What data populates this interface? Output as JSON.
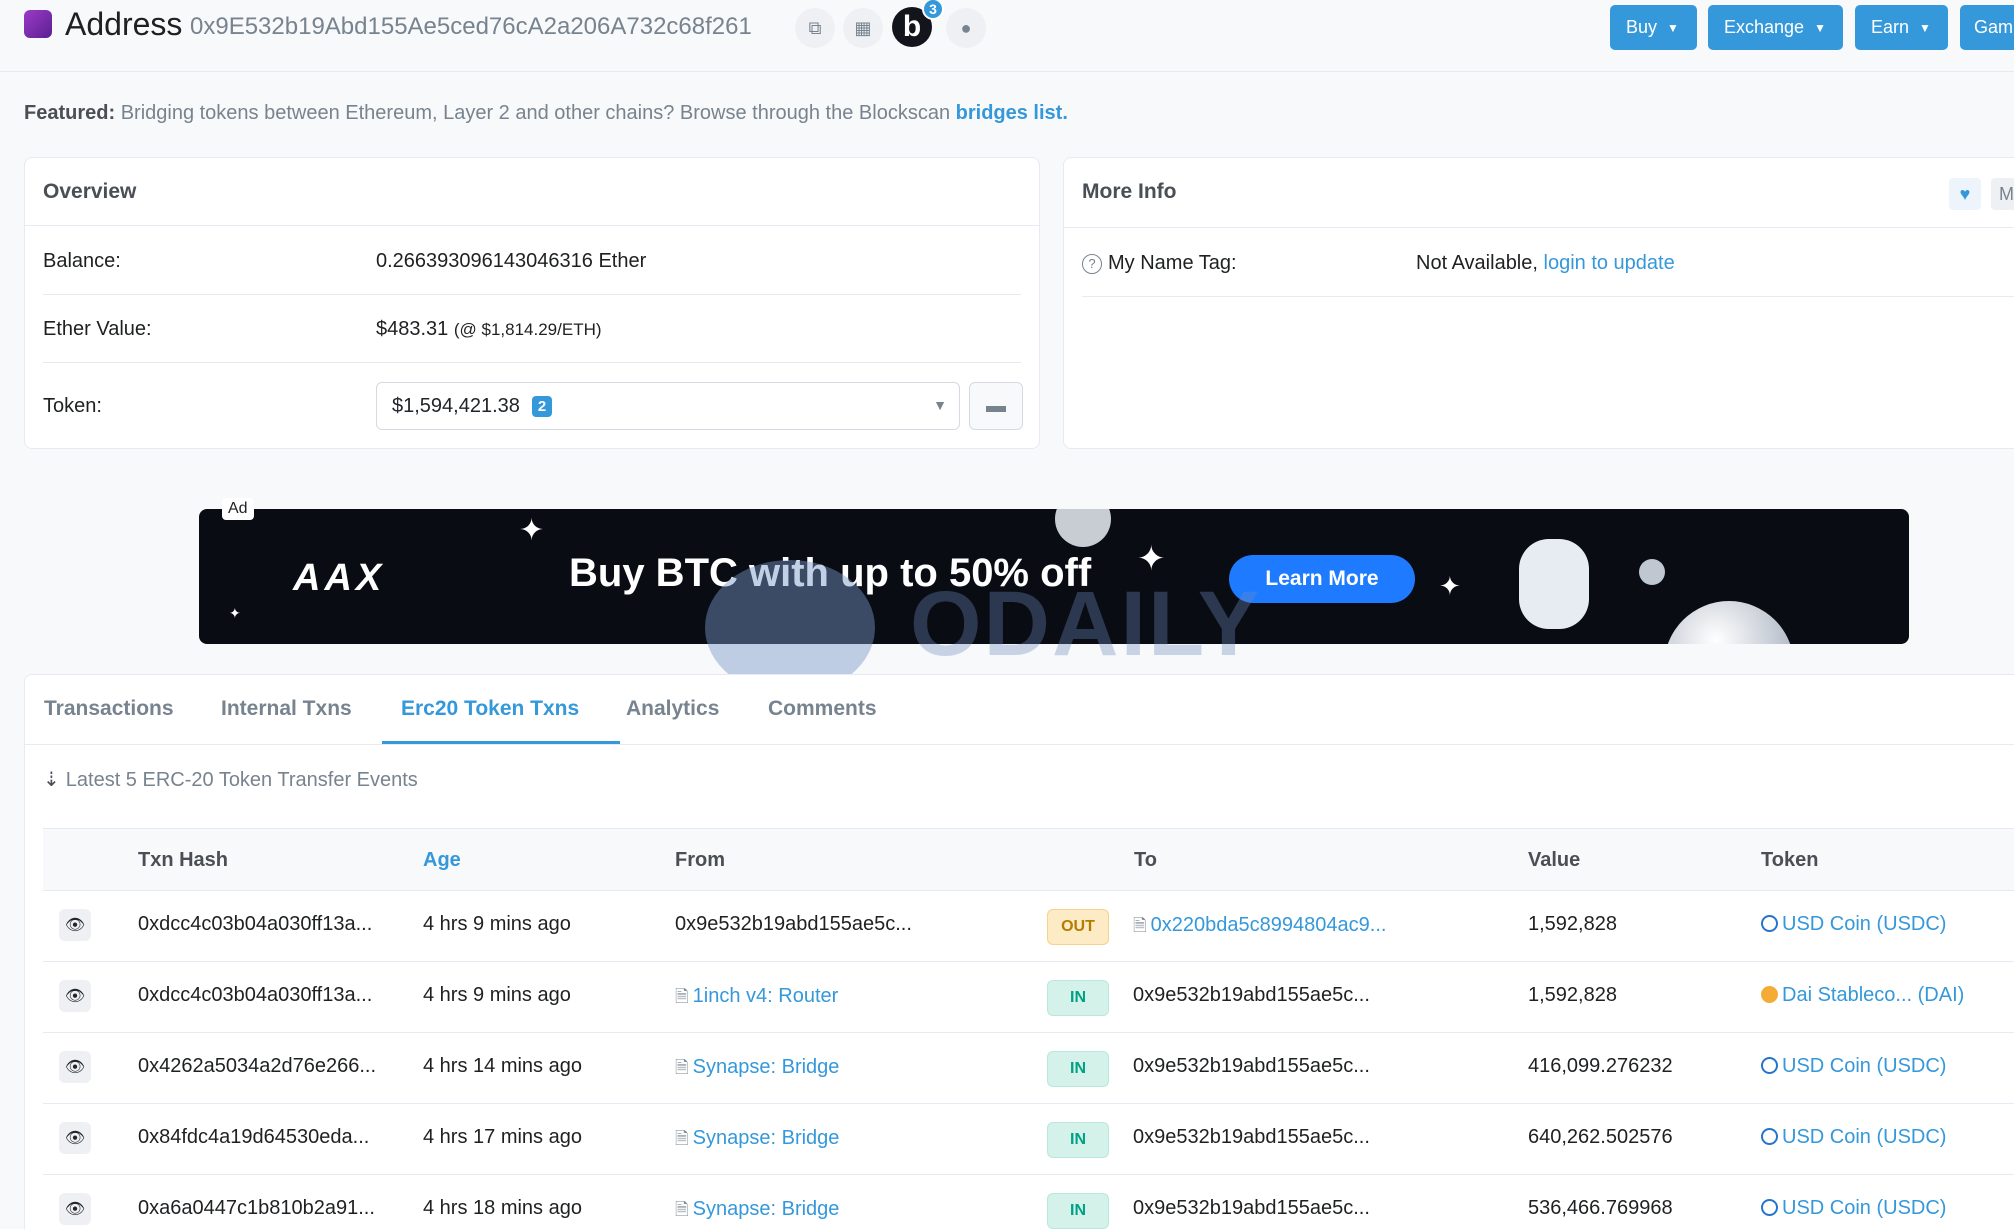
{
  "header": {
    "title": "Address",
    "address": "0x9E532b19Abd155Ae5ced76cA2a206A732c68f261",
    "blockscan_badge": "3",
    "nav": [
      {
        "label": "Buy"
      },
      {
        "label": "Exchange"
      },
      {
        "label": "Earn"
      },
      {
        "label": "Gam"
      }
    ]
  },
  "featured": {
    "label": "Featured:",
    "text": "Bridging tokens between Ethereum, Layer 2 and other chains? Browse through the Blockscan",
    "link": "bridges list."
  },
  "overview": {
    "title": "Overview",
    "balance_label": "Balance:",
    "balance_value": "0.266393096143046316 Ether",
    "ether_value_label": "Ether Value:",
    "ether_value": "$483.31",
    "ether_price": "(@ $1,814.29/ETH)",
    "token_label": "Token:",
    "token_value": "$1,594,421.38",
    "token_count": "2"
  },
  "more_info": {
    "title": "More Info",
    "more_btn": "Mo",
    "name_tag_label": "My Name Tag:",
    "name_tag_value": "Not Available,",
    "name_tag_link": "login to update"
  },
  "ad": {
    "tag": "Ad",
    "brand": "AAX",
    "headline": "Buy BTC with up to 50% off",
    "cta": "Learn More",
    "watermark": "ODAILY"
  },
  "tabs": [
    {
      "label": "Transactions"
    },
    {
      "label": "Internal Txns"
    },
    {
      "label": "Erc20 Token Txns"
    },
    {
      "label": "Analytics"
    },
    {
      "label": "Comments"
    }
  ],
  "latest": "Latest 5 ERC-20 Token Transfer Events",
  "table": {
    "headers": {
      "hash": "Txn Hash",
      "age": "Age",
      "from": "From",
      "to": "To",
      "value": "Value",
      "token": "Token"
    },
    "rows": [
      {
        "hash": "0xdcc4c03b04a030ff13a...",
        "age": "4 hrs 9 mins ago",
        "from": "0x9e532b19abd155ae5c...",
        "dir": "OUT",
        "to": "0x220bda5c8994804ac9...",
        "value": "1,592,828",
        "token": "USD Coin (USDC)"
      },
      {
        "hash": "0xdcc4c03b04a030ff13a...",
        "age": "4 hrs 9 mins ago",
        "from": "1inch v4: Router",
        "dir": "IN",
        "to": "0x9e532b19abd155ae5c...",
        "value": "1,592,828",
        "token": "Dai Stableco... (DAI)"
      },
      {
        "hash": "0x4262a5034a2d76e266...",
        "age": "4 hrs 14 mins ago",
        "from": "Synapse: Bridge",
        "dir": "IN",
        "to": "0x9e532b19abd155ae5c...",
        "value": "416,099.276232",
        "token": "USD Coin (USDC)"
      },
      {
        "hash": "0x84fdc4a19d64530eda...",
        "age": "4 hrs 17 mins ago",
        "from": "Synapse: Bridge",
        "dir": "IN",
        "to": "0x9e532b19abd155ae5c...",
        "value": "640,262.502576",
        "token": "USD Coin (USDC)"
      },
      {
        "hash": "0xa6a0447c1b810b2a91...",
        "age": "4 hrs 18 mins ago",
        "from": "Synapse: Bridge",
        "dir": "IN",
        "to": "0x9e532b19abd155ae5c...",
        "value": "536,466.769968",
        "token": "USD Coin (USDC)"
      }
    ]
  }
}
